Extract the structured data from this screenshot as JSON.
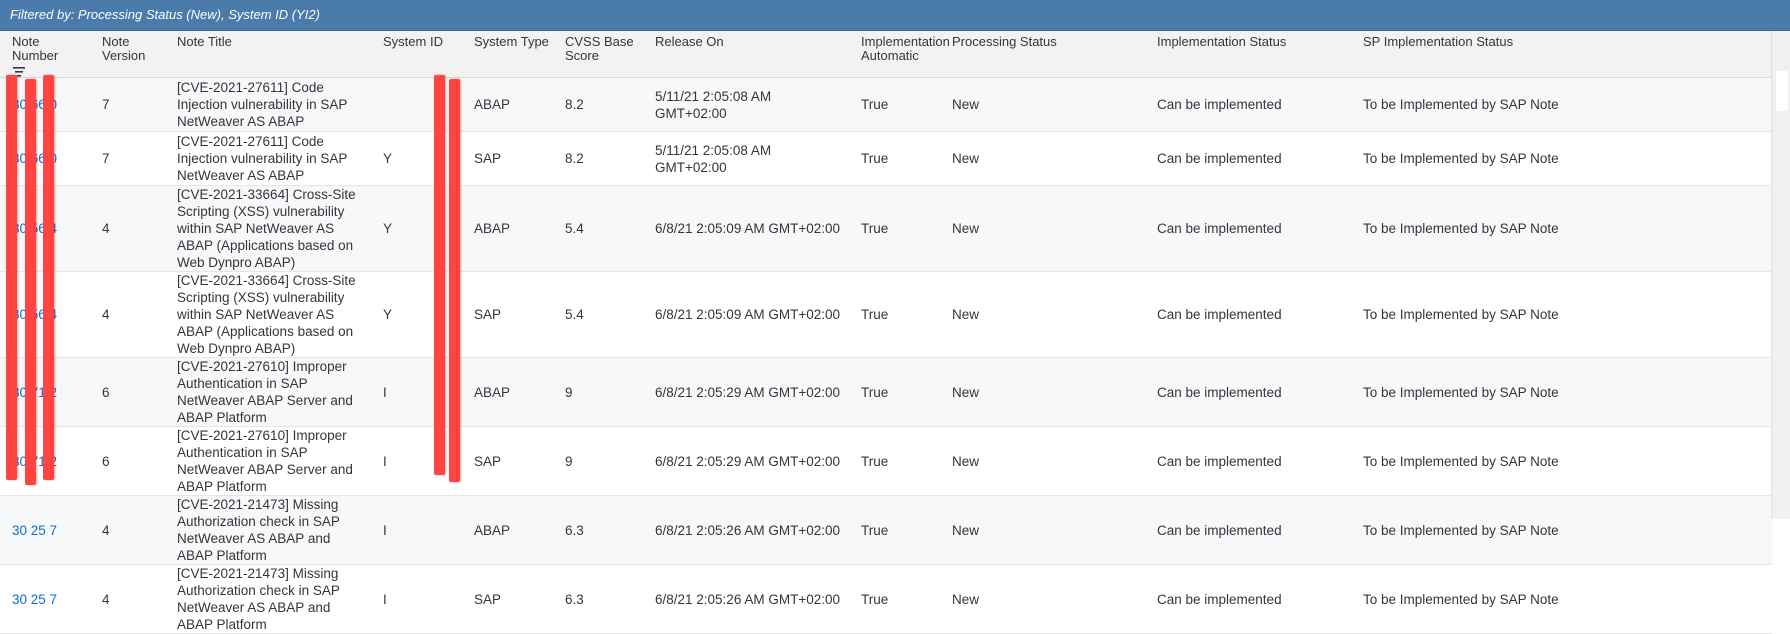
{
  "filter_text": "Filtered by: Processing Status (New), System ID (YI2)",
  "columns": {
    "note_number": "Note Number",
    "note_version": "Note Version",
    "note_title": "Note Title",
    "system_id": "System ID",
    "system_type": "System Type",
    "cvss": "CVSS Base Score",
    "release_on": "Release On",
    "impl_auto": "Implementation Automatic",
    "processing_status": "Processing Status",
    "impl_status": "Implementation Status",
    "sp_impl_status": "SP Implementation Status"
  },
  "icons": {
    "sort": "sort-descending-icon"
  },
  "rows": [
    {
      "note_number": "30 66 0",
      "version": "7",
      "title": "[CVE-2021-27611] Code Injection vulnerability in SAP NetWeaver AS ABAP",
      "system_id": "",
      "system_type": "ABAP",
      "cvss": "8.2",
      "release_on": "5/11/21 2:05:08 AM GMT+02:00",
      "impl_auto": "True",
      "processing_status": "New",
      "impl_status": "Can be implemented",
      "sp_impl_status": "To be Implemented by SAP Note"
    },
    {
      "note_number": "30 66 0",
      "version": "7",
      "title": "[CVE-2021-27611] Code Injection vulnerability in SAP NetWeaver AS ABAP",
      "system_id": "Y",
      "system_type": "SAP",
      "cvss": "8.2",
      "release_on": "5/11/21 2:05:08 AM GMT+02:00",
      "impl_auto": "True",
      "processing_status": "New",
      "impl_status": "Can be implemented",
      "sp_impl_status": "To be Implemented by SAP Note"
    },
    {
      "note_number": "30 56 4",
      "version": "4",
      "title": "[CVE-2021-33664] Cross-Site Scripting (XSS) vulnerability within SAP NetWeaver AS ABAP (Applications based on Web Dynpro ABAP)",
      "system_id": "Y",
      "system_type": "ABAP",
      "cvss": "5.4",
      "release_on": "6/8/21 2:05:09 AM GMT+02:00",
      "impl_auto": "True",
      "processing_status": "New",
      "impl_status": "Can be implemented",
      "sp_impl_status": "To be Implemented by SAP Note"
    },
    {
      "note_number": "30 56 4",
      "version": "4",
      "title": "[CVE-2021-33664] Cross-Site Scripting (XSS) vulnerability within SAP NetWeaver AS ABAP (Applications based on Web Dynpro ABAP)",
      "system_id": "Y",
      "system_type": "SAP",
      "cvss": "5.4",
      "release_on": "6/8/21 2:05:09 AM GMT+02:00",
      "impl_auto": "True",
      "processing_status": "New",
      "impl_status": "Can be implemented",
      "sp_impl_status": "To be Implemented by SAP Note"
    },
    {
      "note_number": "30 71 2",
      "version": "6",
      "title": "[CVE-2021-27610] Improper Authentication in SAP NetWeaver ABAP Server and ABAP Platform",
      "system_id": "I",
      "system_type": "ABAP",
      "cvss": "9",
      "release_on": "6/8/21 2:05:29 AM GMT+02:00",
      "impl_auto": "True",
      "processing_status": "New",
      "impl_status": "Can be implemented",
      "sp_impl_status": "To be Implemented by SAP Note"
    },
    {
      "note_number": "30 71 2",
      "version": "6",
      "title": "[CVE-2021-27610] Improper Authentication in SAP NetWeaver ABAP Server and ABAP Platform",
      "system_id": "I",
      "system_type": "SAP",
      "cvss": "9",
      "release_on": "6/8/21 2:05:29 AM GMT+02:00",
      "impl_auto": "True",
      "processing_status": "New",
      "impl_status": "Can be implemented",
      "sp_impl_status": "To be Implemented by SAP Note"
    },
    {
      "note_number": "30 25 7",
      "version": "4",
      "title": "[CVE-2021-21473] Missing Authorization check in SAP NetWeaver AS ABAP and ABAP Platform",
      "system_id": "I",
      "system_type": "ABAP",
      "cvss": "6.3",
      "release_on": "6/8/21 2:05:26 AM GMT+02:00",
      "impl_auto": "True",
      "processing_status": "New",
      "impl_status": "Can be implemented",
      "sp_impl_status": "To be Implemented by SAP Note"
    },
    {
      "note_number": "30 25 7",
      "version": "4",
      "title": "[CVE-2021-21473] Missing Authorization check in SAP NetWeaver AS ABAP and ABAP Platform",
      "system_id": "I",
      "system_type": "SAP",
      "cvss": "6.3",
      "release_on": "6/8/21 2:05:26 AM GMT+02:00",
      "impl_auto": "True",
      "processing_status": "New",
      "impl_status": "Can be implemented",
      "sp_impl_status": "To be Implemented by SAP Note"
    }
  ],
  "colors": {
    "header_bar": "#4a7bab",
    "link": "#0a6ed1",
    "redaction": "#ff4444"
  }
}
